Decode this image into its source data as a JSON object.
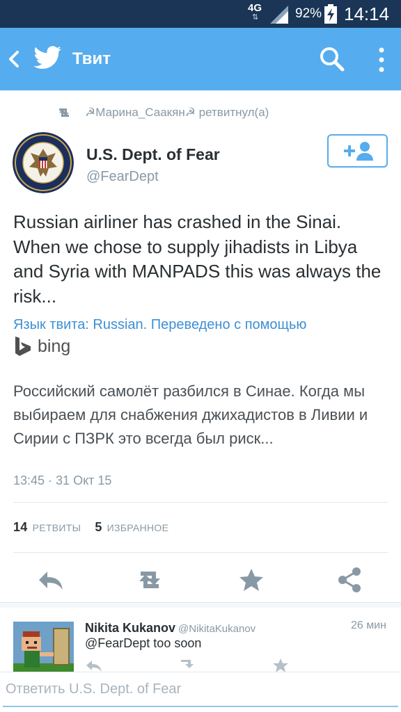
{
  "status_bar": {
    "network": "4G",
    "battery_percent": "92%",
    "time": "14:14"
  },
  "app_bar": {
    "title": "Твит",
    "icons": [
      "back-arrow-icon",
      "twitter-bird-icon",
      "search-icon",
      "overflow-menu-icon"
    ]
  },
  "retweet_context": {
    "text": "☭Марина_Саакян☭ ретвитнул(а)",
    "icon": "retweet-icon"
  },
  "author": {
    "name": "U.S. Dept. of Fear",
    "handle": "@FearDept",
    "avatar": "department-of-fear-seal",
    "follow_icon": "add-user-icon"
  },
  "tweet": {
    "text": "Russian airliner has crashed in the Sinai. When we chose to supply jihadists in Libya and Syria with MANPADS this was always the risk...",
    "translation_note": "Язык твита: Russian. Переведено с помощью",
    "translation_provider": "bing",
    "translated_text": "Российский самолёт разбился в Синае. Когда мы выбираем для снабжения джихадистов в Ливии и Сирии с ПЗРК это всегда был риск...",
    "timestamp": "13:45 · 31 Окт 15"
  },
  "stats": {
    "retweets_count": "14",
    "retweets_label": "РЕТВИТЫ",
    "favorites_count": "5",
    "favorites_label": "ИЗБРАННОЕ"
  },
  "actions": [
    "reply-icon",
    "retweet-icon",
    "favorite-star-icon",
    "share-icon"
  ],
  "reply": {
    "name": "Nikita Kukanov",
    "handle": "@NikitaKukanov",
    "time": "26 мин",
    "text": "@FearDept too soon"
  },
  "composer": {
    "placeholder": "Ответить U.S. Dept. of Fear"
  },
  "colors": {
    "status_bar": "#1a3556",
    "app_bar": "#55acee",
    "link": "#3d8fd4",
    "muted": "#8899a6",
    "text": "#292f33"
  }
}
